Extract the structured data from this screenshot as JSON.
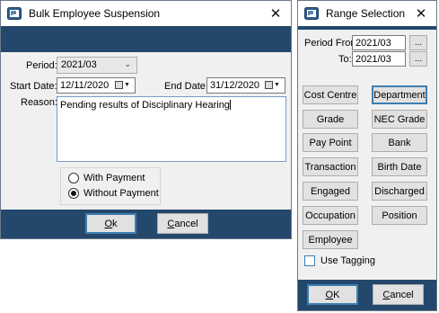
{
  "suspension": {
    "title": "Bulk Employee Suspension",
    "close": "✕",
    "period_label": "Period:",
    "period_value": "2021/03",
    "start_label": "Start Date:",
    "start_value": "12/11/2020",
    "end_label": "End Date:",
    "end_value": "31/12/2020",
    "reason_label": "Reason:",
    "reason_value": "Pending results of Disciplinary Hearing",
    "options": [
      {
        "label": "With Payment",
        "selected": false
      },
      {
        "label": "Without Payment",
        "selected": true
      }
    ],
    "ok": {
      "pre": "",
      "u": "O",
      "post": "k"
    },
    "cancel": {
      "pre": "",
      "u": "C",
      "post": "ancel"
    }
  },
  "range": {
    "title": "Range Selection",
    "close": "✕",
    "from_label": "Period From:",
    "from_value": "2021/03",
    "to_label": "To:",
    "to_value": "2021/03",
    "ellipsis": "...",
    "buttons": [
      "Cost Centre",
      "Department",
      "Grade",
      "NEC Grade",
      "Pay Point",
      "Bank",
      "Transaction",
      "Birth Date",
      "Engaged",
      "Discharged",
      "Occupation",
      "Position",
      "Employee"
    ],
    "active_button": "Department",
    "use_tagging": "Use Tagging",
    "ok": {
      "pre": "",
      "u": "O",
      "post": "K"
    },
    "cancel": {
      "pre": "",
      "u": "C",
      "post": "ancel"
    }
  },
  "colors": {
    "band": "#24486c",
    "focus": "#3c7fb1"
  },
  "icons": [
    "app-icon",
    "close-icon",
    "chevron-down-icon",
    "calendar-icon"
  ]
}
